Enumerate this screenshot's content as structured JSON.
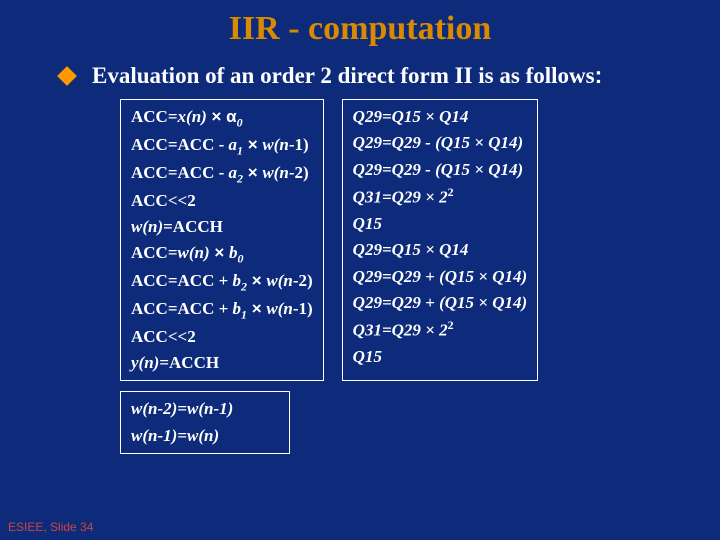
{
  "title": "IIR - computation",
  "bullet": "Evaluation of an order 2 direct form II is as follows",
  "colon": ":",
  "left": {
    "r0a": "ACC=",
    "r0b": "x(n)",
    "r0c": " × α",
    "r0d": "0",
    "r1a": "ACC=ACC - ",
    "r1b": "a",
    "r1b2": "1",
    "r1c": " × ",
    "r1d": "w(n",
    "r1e": "-1)",
    "r2a": "ACC=ACC - ",
    "r2b": "a",
    "r2b2": "2",
    "r2c": " × ",
    "r2d": "w(n",
    "r2e": "-2)",
    "r3": "ACC<<2",
    "r4a": "w(n)",
    "r4b": "=ACCH",
    "r5a": "ACC=",
    "r5b": "w(n)",
    "r5c": " × ",
    "r5d": "b",
    "r5d2": "0",
    "r6a": "ACC=ACC + ",
    "r6b": "b",
    "r6b2": "2",
    "r6c": " × ",
    "r6d": "w(n",
    "r6e": "-2)",
    "r7a": "ACC=ACC + ",
    "r7b": "b",
    "r7b2": "1",
    "r7c": " × ",
    "r7d": "w(n",
    "r7e": "-1)",
    "r8": "ACC<<2",
    "r9a": "y(n)",
    "r9b": "=ACCH"
  },
  "right": {
    "r0": "Q29=Q15 × Q14",
    "r1": "Q29=Q29 - (Q15 × Q14)",
    "r2": "Q29=Q29 - (Q15 × Q14)",
    "r3a": "Q31=Q29 × 2",
    "r3b": "2",
    "r4": "Q15",
    "r5": "Q29=Q15 × Q14",
    "r6": "Q29=Q29 + (Q15 × Q14)",
    "r7": "Q29=Q29 + (Q15 × Q14)",
    "r8a": "Q31=Q29 × 2",
    "r8b": "2",
    "r9": "Q15"
  },
  "bottom": {
    "r0a": "w(n",
    "r0b": "-2)=",
    "r0c": "w(n",
    "r0d": "-1)",
    "r1a": "w(n",
    "r1b": "-1)=",
    "r1c": "w(n)"
  },
  "footer": "ESIEE, Slide 34"
}
